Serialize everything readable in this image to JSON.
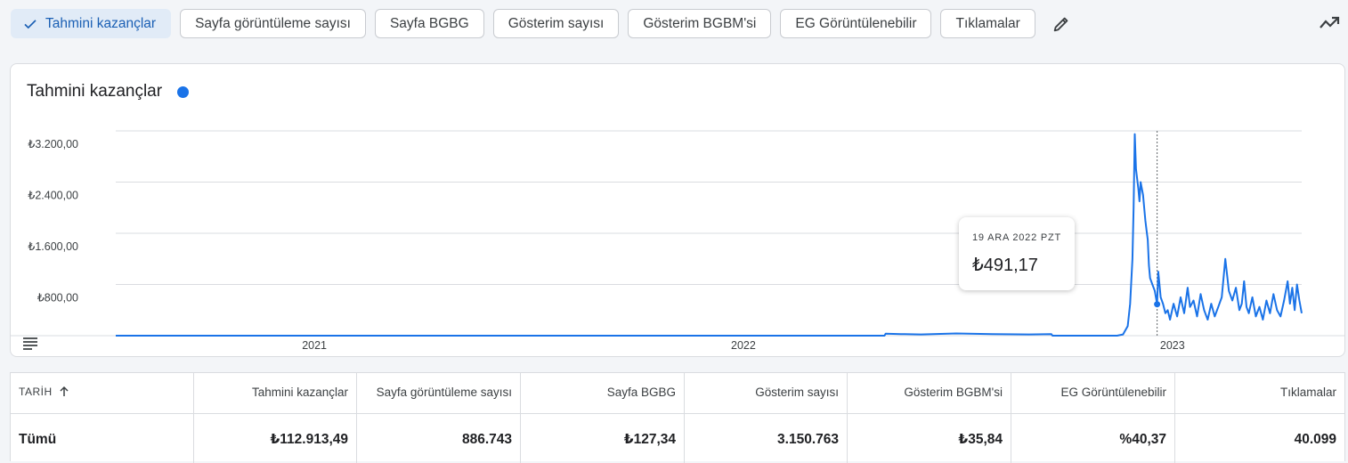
{
  "metrics": {
    "selected": "Tahmini kazançlar",
    "chips": [
      "Sayfa görüntüleme sayısı",
      "Sayfa BGBG",
      "Gösterim sayısı",
      "Gösterim BGBM'si",
      "EG Görüntülenebilir",
      "Tıklamalar"
    ],
    "icons": {
      "selected": "check-icon",
      "edit": "pencil-icon",
      "trend": "trend-icon"
    }
  },
  "chart_card": {
    "title": "Tahmini kazançlar",
    "legend_color": "#1a73e8",
    "menu_icon": "table-menu-icon"
  },
  "tooltip": {
    "date": "19 ARA 2022 PZT",
    "value": "₺491,17"
  },
  "chart_data": {
    "type": "line",
    "title": "Tahmini kazançlar",
    "xlabel": "",
    "ylabel": "",
    "y_ticks": [
      "₺3.200,00",
      "₺2.400,00",
      "₺1.600,00",
      "₺800,00"
    ],
    "y_tick_values": [
      3200,
      2400,
      1600,
      800
    ],
    "ylim": [
      0,
      3200
    ],
    "x_ticks": [
      "2021",
      "2022",
      "2023"
    ],
    "x_tick_dates": [
      "2021-01-01",
      "2022-01-01",
      "2023-01-01"
    ],
    "xlim": [
      "2020-07-16",
      "2023-04-21"
    ],
    "grid": true,
    "line_color": "#1a73e8",
    "hover_date": "2022-12-19",
    "series": [
      {
        "name": "Tahmini kazançlar",
        "x": [
          "2020-07-16",
          "2022-05-01",
          "2022-05-02",
          "2022-05-15",
          "2022-06-01",
          "2022-07-01",
          "2022-08-01",
          "2022-09-01",
          "2022-09-20",
          "2022-09-21",
          "2022-11-15",
          "2022-11-20",
          "2022-11-24",
          "2022-11-26",
          "2022-11-28",
          "2022-11-29",
          "2022-11-30",
          "2022-12-01",
          "2022-12-03",
          "2022-12-04",
          "2022-12-05",
          "2022-12-07",
          "2022-12-08",
          "2022-12-09",
          "2022-12-10",
          "2022-12-11",
          "2022-12-12",
          "2022-12-13",
          "2022-12-15",
          "2022-12-17",
          "2022-12-19",
          "2022-12-20",
          "2022-12-22",
          "2022-12-24",
          "2022-12-26",
          "2022-12-28",
          "2022-12-30",
          "2023-01-02",
          "2023-01-05",
          "2023-01-08",
          "2023-01-11",
          "2023-01-14",
          "2023-01-16",
          "2023-01-19",
          "2023-01-22",
          "2023-01-25",
          "2023-01-28",
          "2023-01-31",
          "2023-02-03",
          "2023-02-06",
          "2023-02-09",
          "2023-02-12",
          "2023-02-15",
          "2023-02-18",
          "2023-02-21",
          "2023-02-24",
          "2023-02-27",
          "2023-03-01",
          "2023-03-03",
          "2023-03-05",
          "2023-03-07",
          "2023-03-10",
          "2023-03-13",
          "2023-03-16",
          "2023-03-19",
          "2023-03-22",
          "2023-03-25",
          "2023-03-28",
          "2023-03-31",
          "2023-04-03",
          "2023-04-06",
          "2023-04-09",
          "2023-04-11",
          "2023-04-13",
          "2023-04-15",
          "2023-04-17",
          "2023-04-19",
          "2023-04-21"
        ],
        "y": [
          0,
          0,
          30,
          25,
          20,
          35,
          25,
          20,
          25,
          0,
          0,
          20,
          150,
          500,
          1200,
          2000,
          3150,
          2600,
          2300,
          2100,
          2400,
          2200,
          2000,
          1800,
          1650,
          1500,
          1100,
          900,
          800,
          700,
          491,
          1000,
          600,
          500,
          350,
          400,
          250,
          500,
          300,
          600,
          350,
          750,
          450,
          550,
          300,
          650,
          400,
          250,
          500,
          300,
          450,
          600,
          1200,
          700,
          550,
          750,
          400,
          500,
          850,
          450,
          350,
          600,
          300,
          450,
          250,
          550,
          350,
          650,
          400,
          300,
          550,
          850,
          500,
          750,
          400,
          800,
          550,
          350
        ]
      }
    ]
  },
  "table": {
    "sort_icon": "arrow-up-icon",
    "columns": [
      "TARİH",
      "Tahmini kazançlar",
      "Sayfa görüntüleme sayısı",
      "Sayfa BGBG",
      "Gösterim sayısı",
      "Gösterim BGBM'si",
      "EG Görüntülenebilir",
      "Tıklamalar"
    ],
    "total": [
      "Tümü",
      "₺112.913,49",
      "886.743",
      "₺127,34",
      "3.150.763",
      "₺35,84",
      "%40,37",
      "40.099"
    ]
  }
}
